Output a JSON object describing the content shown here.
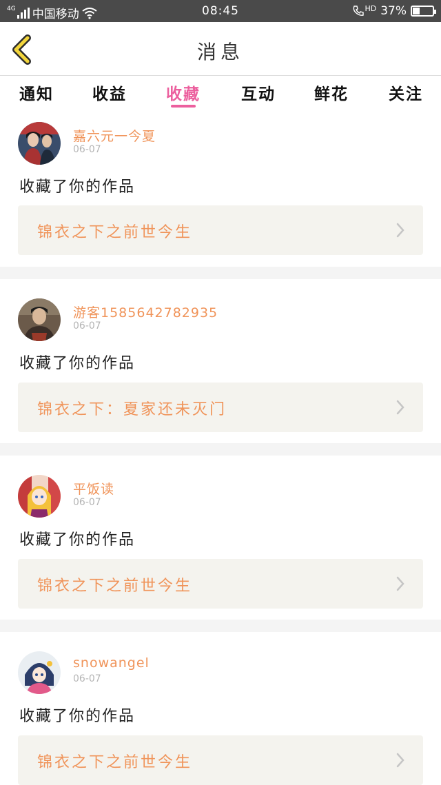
{
  "status_bar": {
    "network_type": "4G",
    "carrier": "中国移动",
    "time": "08:45",
    "hd_label": "HD",
    "battery_percent": "37%",
    "battery_level": 0.37
  },
  "header": {
    "title": "消息"
  },
  "tabs": [
    {
      "label": "通知"
    },
    {
      "label": "收益"
    },
    {
      "label": "收藏"
    },
    {
      "label": "互动"
    },
    {
      "label": "鲜花"
    },
    {
      "label": "关注"
    }
  ],
  "active_tab": "收藏",
  "accent_color": "#ec5f9e",
  "name_color": "#f0945a",
  "items": [
    {
      "username": "嘉六元一今夏",
      "date": "06-07",
      "action": "收藏了你的作品",
      "work_title": "锦衣之下之前世今生",
      "avatar": "avatar-portrait-red"
    },
    {
      "username": "游客1585642782935",
      "date": "06-07",
      "action": "收藏了你的作品",
      "work_title": "锦衣之下：夏家还未灭门",
      "avatar": "avatar-portrait-dark"
    },
    {
      "username": "平饭读",
      "date": "06-07",
      "action": "收藏了你的作品",
      "work_title": "锦衣之下之前世今生",
      "avatar": "avatar-anime-yellow"
    },
    {
      "username": "snowangel",
      "date": "06-07",
      "action": "收藏了你的作品",
      "work_title": "锦衣之下之前世今生",
      "avatar": "avatar-anime-blue"
    }
  ]
}
